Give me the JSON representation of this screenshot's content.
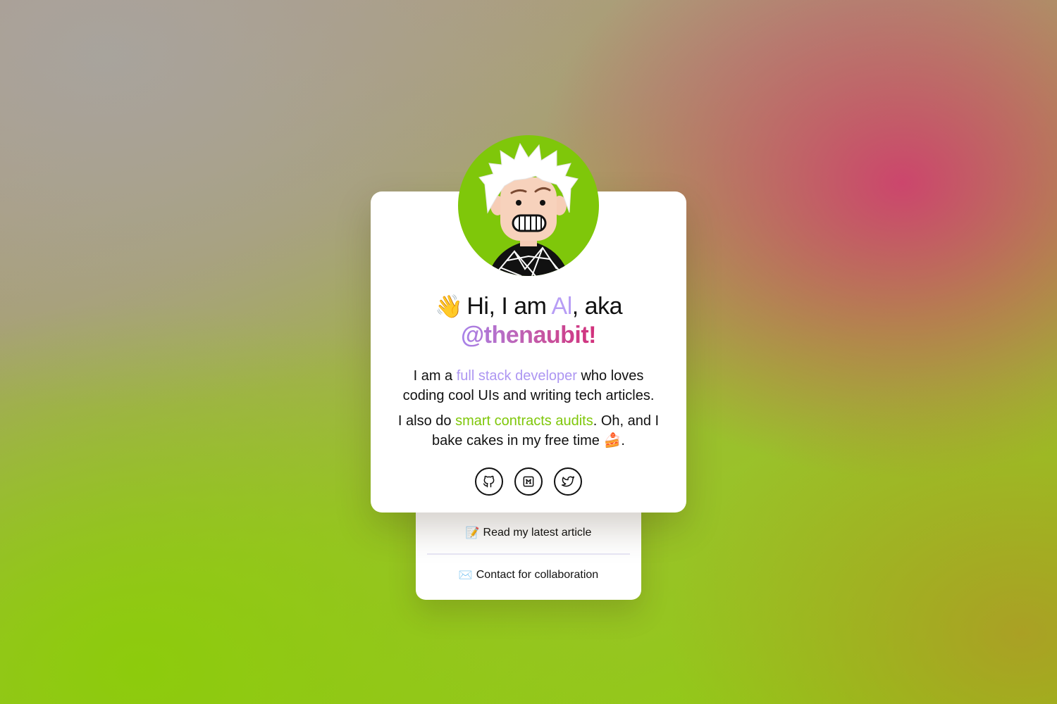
{
  "profile": {
    "wave_emoji": "👋",
    "greeting_prefix": "Hi, I am ",
    "name": "Al",
    "greeting_suffix": ", aka",
    "handle": "@thenaubit!",
    "bio_line1_prefix": "I am a ",
    "bio_line1_link": "full stack developer",
    "bio_line1_suffix": " who loves coding cool UIs and writing tech articles.",
    "bio_line2_prefix": "I also do ",
    "bio_line2_link": "smart contracts audits",
    "bio_line2_suffix": ". Oh, and I bake cakes in my free time ",
    "cake_emoji": "🍰",
    "bio_line2_end": "."
  },
  "socials": [
    {
      "name": "github",
      "icon": "github-icon"
    },
    {
      "name": "medium",
      "icon": "medium-icon"
    },
    {
      "name": "twitter",
      "icon": "twitter-icon"
    }
  ],
  "links": {
    "article_emoji": "📝",
    "article_label": "Read my latest article",
    "contact_emoji": "✉️",
    "contact_label": "Contact for collaboration"
  },
  "colors": {
    "accent_purple": "#ad96f2",
    "accent_green": "#7fc70a",
    "avatar_bg": "#7fc70a",
    "handle_gradient_start": "#a783ea",
    "handle_gradient_end": "#d2307a"
  }
}
